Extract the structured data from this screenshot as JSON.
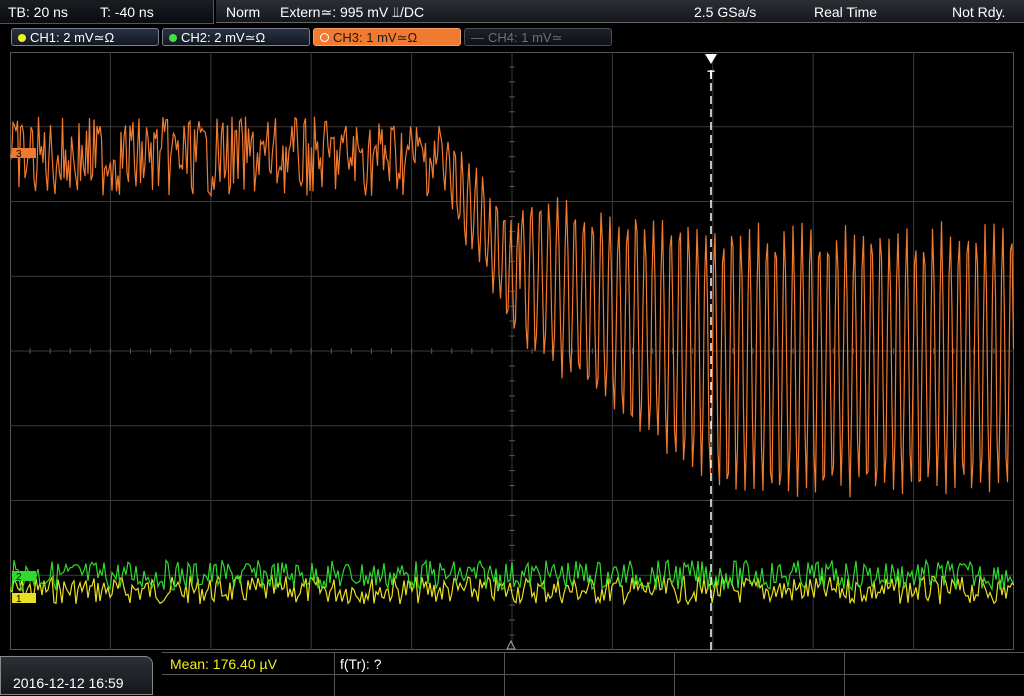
{
  "timebase": {
    "tb_label": "TB: 20 ns",
    "trigger_time_label": "T: -40 ns"
  },
  "status": {
    "mode": "Norm",
    "trigger": "Extern≃: 995 mV ⫫/DC",
    "sample_rate": "2.5 GSa/s",
    "acq_mode": "Real Time",
    "ready": "Not Rdy."
  },
  "channels": [
    {
      "label": "CH1: 2 mV≃Ω",
      "color": "#f0f020",
      "active": false,
      "enabled": true
    },
    {
      "label": "CH2: 2 mV≃Ω",
      "color": "#40e040",
      "active": false,
      "enabled": true
    },
    {
      "label": "CH3: 1 mV≃Ω",
      "color": "#f07a30",
      "active": true,
      "enabled": true
    },
    {
      "label": "CH4: 1 mV≃",
      "color": "#6a6f78",
      "active": false,
      "enabled": false
    }
  ],
  "markers": {
    "ch3": "3",
    "ch2": "2",
    "ch1": "1",
    "trigger": "T"
  },
  "waveforms": {
    "ch1_color": "#e8e020",
    "ch2_color": "#30d830",
    "ch3_color": "#f07a30",
    "ch3_high_level_div": 2.6,
    "ch3_low_level_div": -0.4,
    "ch1_level_div": -3.2,
    "ch2_level_div": -3.0
  },
  "datetime": "2016-12-12 16:59",
  "measurements": {
    "mean": "Mean: 176.40 µV",
    "ftr": "f(Tr): ?"
  }
}
